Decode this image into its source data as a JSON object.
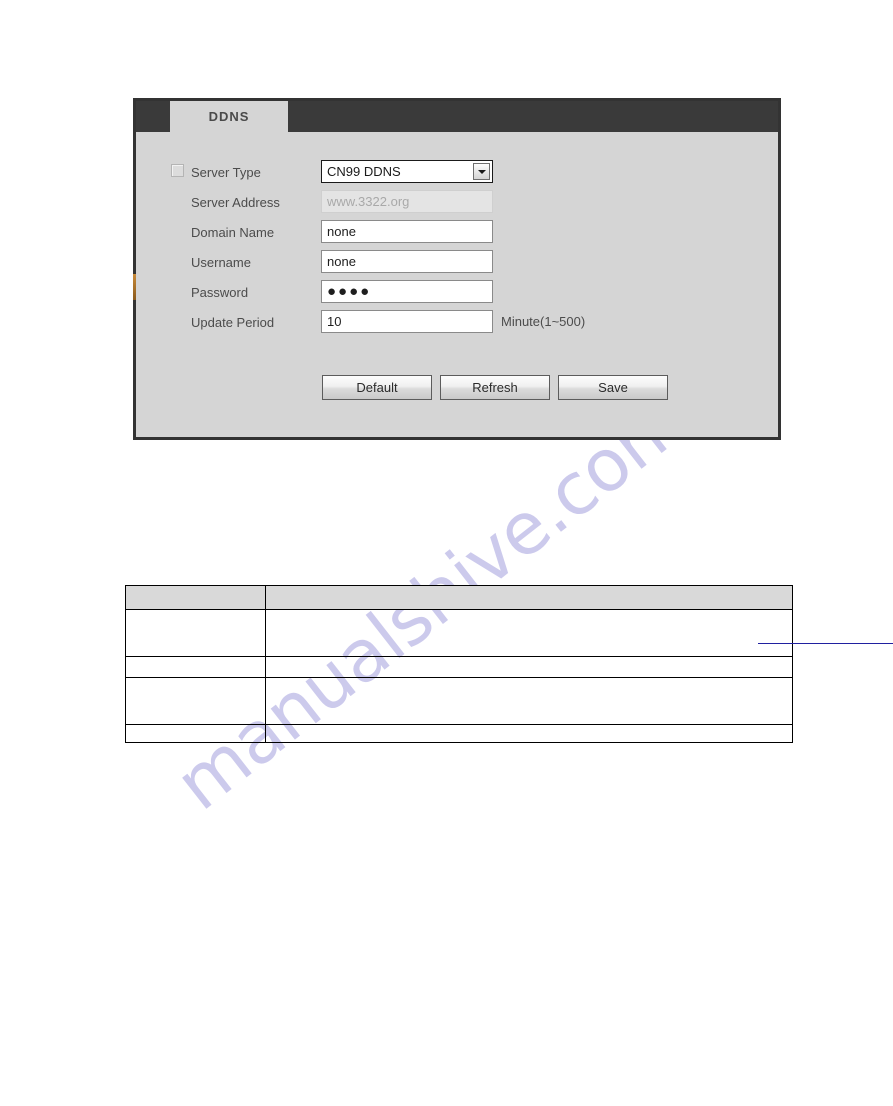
{
  "page": {
    "background": "#ffffff",
    "watermark_text": "manualshive.com",
    "watermark_color": "#b9b6e6"
  },
  "ddns_panel": {
    "tab": {
      "label": "DDNS"
    },
    "colors": {
      "panel_bg": "#d5d5d5",
      "tabbar_bg": "#3a3a3a",
      "border": "#333333"
    },
    "fields": [
      {
        "name": "server-type",
        "label": "Server Type",
        "control": "select",
        "value": "CN99 DDNS",
        "has_checkbox": true,
        "checkbox_checked": false,
        "disabled": false
      },
      {
        "name": "server-address",
        "label": "Server Address",
        "control": "text",
        "value": "www.3322.org",
        "disabled": true
      },
      {
        "name": "domain-name",
        "label": "Domain Name",
        "control": "text",
        "value": "none",
        "disabled": false
      },
      {
        "name": "username",
        "label": "Username",
        "control": "text",
        "value": "none",
        "disabled": false
      },
      {
        "name": "password",
        "label": "Password",
        "control": "password",
        "value": "●●●●",
        "disabled": false
      },
      {
        "name": "update-period",
        "label": "Update Period",
        "control": "text",
        "value": "10",
        "unit": "Minute(1~500)",
        "disabled": false
      }
    ],
    "buttons": {
      "default_label": "Default",
      "refresh_label": "Refresh",
      "save_label": "Save"
    }
  },
  "desc_table": {
    "headers": [
      "",
      ""
    ],
    "rows": [
      {
        "param": "",
        "description": "",
        "has_link": true
      },
      {
        "param": "",
        "description": "",
        "has_link": false
      },
      {
        "param": "",
        "description": "",
        "has_link": false
      },
      {
        "param": "",
        "description": "",
        "has_link": false
      }
    ]
  }
}
